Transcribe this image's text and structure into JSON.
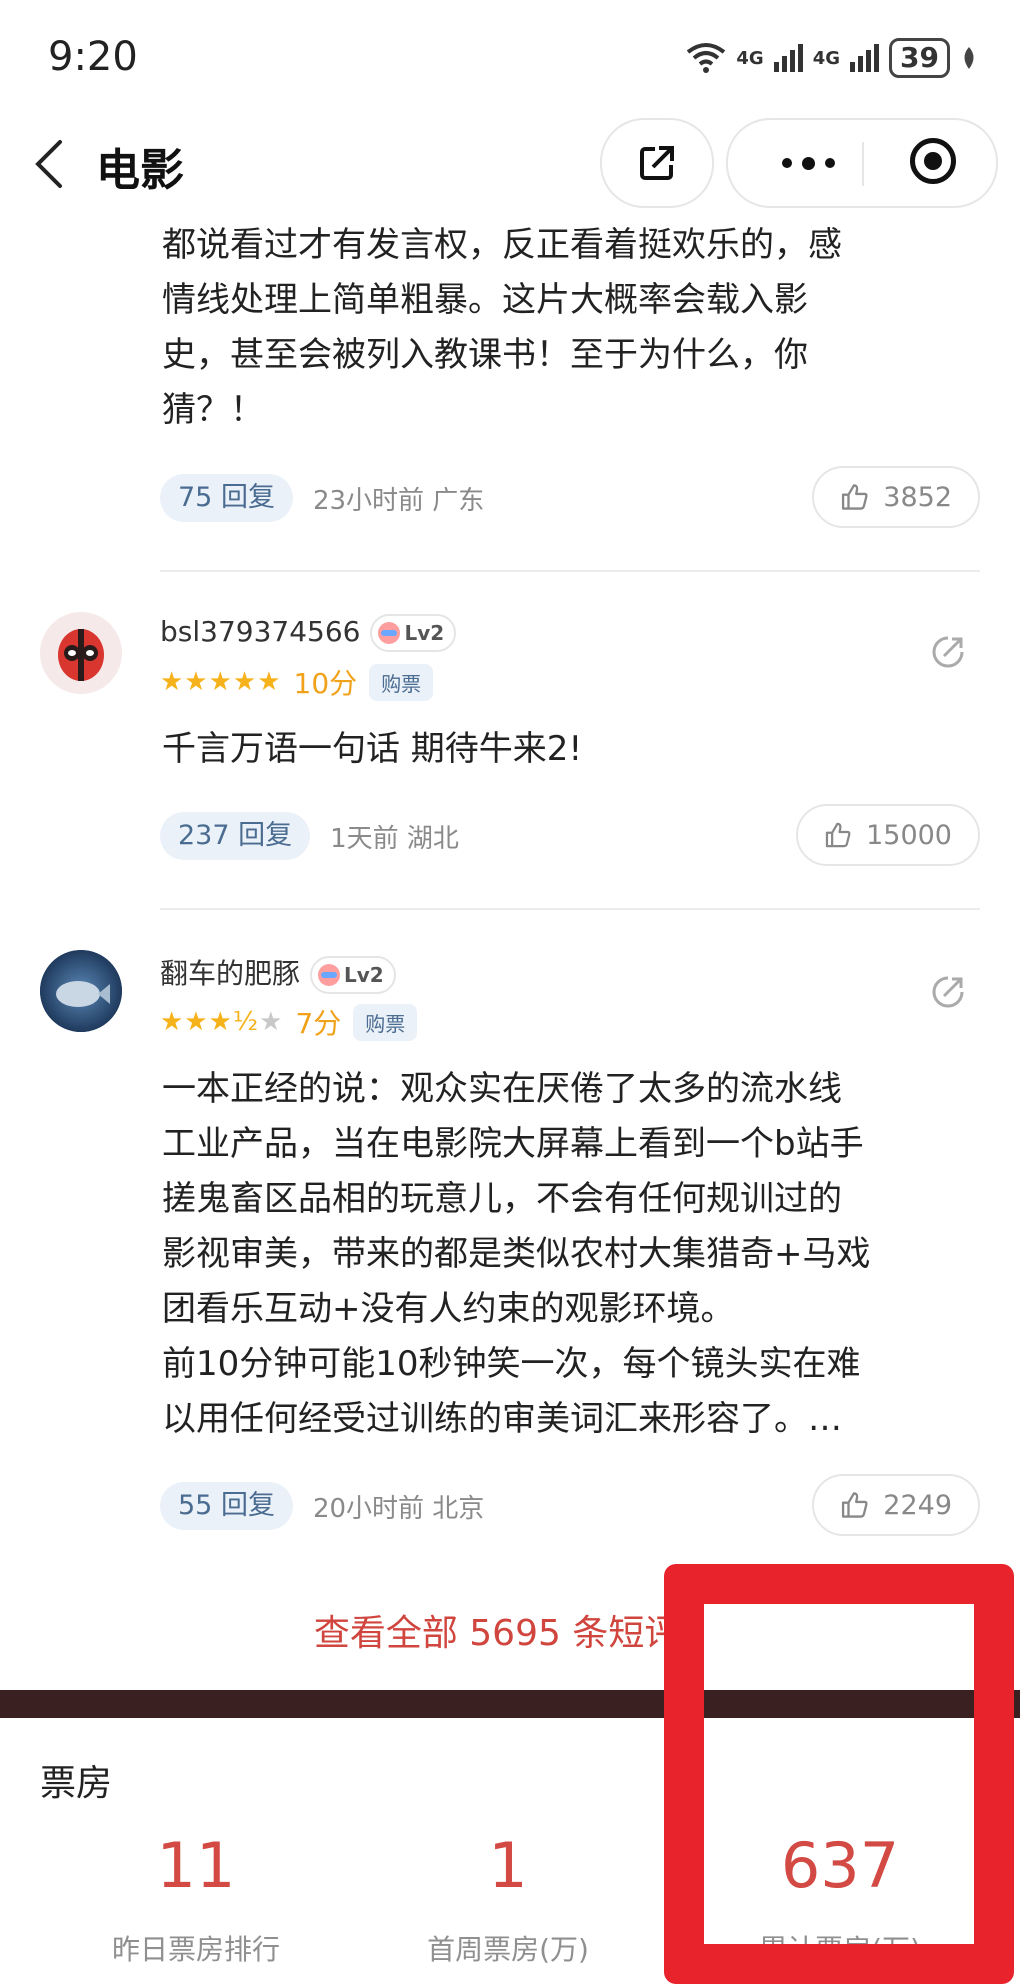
{
  "status_bar": {
    "time": "9:20",
    "network_1": "4G",
    "network_2": "4G",
    "battery": "39"
  },
  "nav": {
    "title": "电影"
  },
  "comments": [
    {
      "text": "都说看过才有发言权，反正看着挺欢乐的，感\n情线处理上简单粗暴。这片大概率会载入影\n史，甚至会被列入教课书！至于为什么，你\n猜？！",
      "replies": "75 回复",
      "meta": "23小时前 广东",
      "likes": "3852"
    },
    {
      "username": "bsl379374566",
      "level": "Lv2",
      "score": "10分",
      "tag": "购票",
      "text": "千言万语一句话  期待牛来2!",
      "replies": "237 回复",
      "meta": "1天前 湖北",
      "likes": "15000"
    },
    {
      "username": "翻车的肥豚",
      "level": "Lv2",
      "score": "7分",
      "tag": "购票",
      "text": "一本正经的说：观众实在厌倦了太多的流水线\n工业产品，当在电影院大屏幕上看到一个b站手\n搓鬼畜区品相的玩意儿，不会有任何规训过的\n影视审美，带来的都是类似农村大集猎奇+马戏\n团看乐互动+没有人约束的观影环境。\n前10分钟可能10秒钟笑一次，每个镜头实在难\n以用任何经受过训练的审美词汇来形容了。…",
      "replies": "55 回复",
      "meta": "20小时前 北京",
      "likes": "2249"
    }
  ],
  "view_all": "查看全部 5695 条短评 ›",
  "box_office": {
    "title": "票房",
    "stats": [
      {
        "value": "11",
        "label": "昨日票房排行"
      },
      {
        "value": "1",
        "label": "首周票房(万)"
      },
      {
        "value": "637",
        "label": "累计票房(万)"
      }
    ]
  },
  "colors": {
    "accent_red": "#d24a43",
    "highlight": "#e8232b",
    "star": "#f6b21b"
  }
}
